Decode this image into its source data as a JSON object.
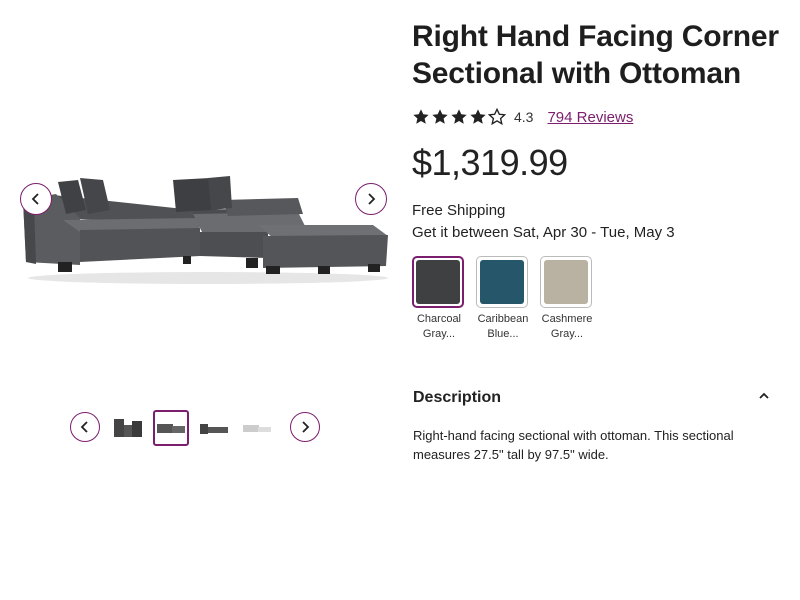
{
  "product": {
    "title": "Right Hand Facing Corner Sectional with Ottoman",
    "rating": "4.3",
    "rating_stars": 4.3,
    "reviews_link": "794 Reviews",
    "price": "$1,319.99",
    "shipping": "Free Shipping",
    "delivery": "Get it between Sat, Apr 30 - Tue, May 3"
  },
  "swatches": [
    {
      "line1": "Charcoal",
      "line2": "Gray...",
      "color": "#3f4042",
      "selected": true
    },
    {
      "line1": "Caribbean",
      "line2": "Blue...",
      "color": "#25566a",
      "selected": false
    },
    {
      "line1": "Cashmere",
      "line2": "Gray...",
      "color": "#b9b2a3",
      "selected": false
    }
  ],
  "description": {
    "heading": "Description",
    "text": "Right-hand facing sectional with ottoman. This sectional measures 27.5\" tall by 97.5\" wide."
  },
  "colors": {
    "accent": "#7b1e6e",
    "sofa": "#56585b"
  },
  "icons": {
    "prev": "chevron-left-icon",
    "next": "chevron-right-icon",
    "collapse": "chevron-up-icon",
    "star": "star-icon"
  }
}
